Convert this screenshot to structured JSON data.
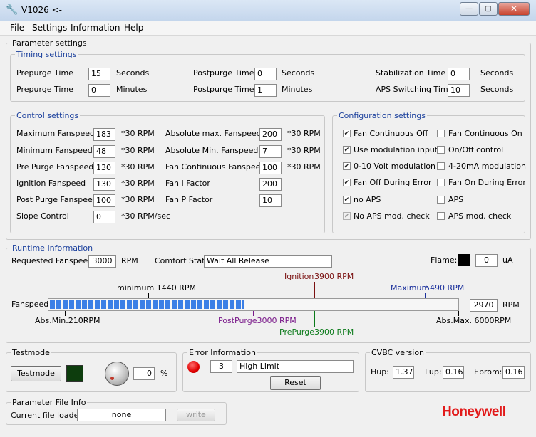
{
  "window": {
    "title": "V1026  <-"
  },
  "menu": [
    "File",
    "Settings",
    "Information",
    "Help"
  ],
  "parameter_settings": {
    "legend": "Parameter settings",
    "timing": {
      "legend": "Timing settings",
      "rows": [
        {
          "label": "Prepurge Time",
          "value": "15",
          "unit": "Seconds"
        },
        {
          "label": "Prepurge Time",
          "value": "0",
          "unit": "Minutes"
        },
        {
          "label": "Postpurge Time",
          "value": "0",
          "unit": "Seconds"
        },
        {
          "label": "Postpurge Time",
          "value": "1",
          "unit": "Minutes"
        },
        {
          "label": "Stabilization Time",
          "value": "0",
          "unit": "Seconds"
        },
        {
          "label": "APS Switching Time",
          "value": "10",
          "unit": "Seconds"
        }
      ]
    },
    "control": {
      "legend": "Control settings",
      "left": [
        {
          "label": "Maximum Fanspeed",
          "value": "183",
          "unit": "*30 RPM"
        },
        {
          "label": "Minimum Fanspeed",
          "value": "48",
          "unit": "*30 RPM"
        },
        {
          "label": "Pre Purge Fanspeed",
          "value": "130",
          "unit": "*30 RPM"
        },
        {
          "label": "Ignition Fanspeed",
          "value": "130",
          "unit": "*30 RPM"
        },
        {
          "label": "Post Purge Fanspeed",
          "value": "100",
          "unit": "*30 RPM"
        },
        {
          "label": "Slope Control",
          "value": "0",
          "unit": "*30 RPM/sec"
        }
      ],
      "right": [
        {
          "label": "Absolute max. Fanspeed",
          "value": "200",
          "unit": "*30 RPM"
        },
        {
          "label": "Absolute Min. Fanspeed",
          "value": "7",
          "unit": "*30 RPM"
        },
        {
          "label": "Fan Continuous Fanspeed",
          "value": "100",
          "unit": "*30 RPM"
        },
        {
          "label": "Fan I Factor",
          "value": "200",
          "unit": ""
        },
        {
          "label": "Fan P Factor",
          "value": "10",
          "unit": ""
        }
      ]
    },
    "config": {
      "legend": "Configuration settings",
      "left": [
        {
          "label": "Fan Continuous Off",
          "checked": true
        },
        {
          "label": "Use modulation input",
          "checked": true
        },
        {
          "label": "0-10 Volt modulation",
          "checked": true
        },
        {
          "label": "Fan Off During Error",
          "checked": true
        },
        {
          "label": "no APS",
          "checked": true
        },
        {
          "label": "No APS mod. check",
          "checked": true
        }
      ],
      "right": [
        {
          "label": "Fan Continuous On",
          "checked": false
        },
        {
          "label": "On/Off control",
          "checked": false
        },
        {
          "label": "4-20mA modulation",
          "checked": false
        },
        {
          "label": "Fan On During Error",
          "checked": false
        },
        {
          "label": "APS",
          "checked": false
        },
        {
          "label": "APS mod. check",
          "checked": false
        }
      ]
    }
  },
  "runtime": {
    "legend": "Runtime Information",
    "requested_label": "Requested Fanspeed:",
    "requested_value": "3000",
    "requested_unit": "RPM",
    "comfort_label": "Comfort State:",
    "comfort_value": "Wait All Release",
    "flame_label": "Flame:",
    "flame_value": "0",
    "flame_unit": "uA",
    "fanspeed_label": "Fanspeed",
    "fanspeed_value": "2970",
    "fanspeed_unit": "RPM",
    "bar_fill_fraction": 0.475,
    "markers": {
      "minimum": "minimum 1440 RPM",
      "ignition": "Ignition",
      "ignition_value": "3900 RPM",
      "maximum": "Maximum",
      "maximum_value": "5490 RPM",
      "abs_min": "Abs.Min.210RPM",
      "postpurge": "PostPurge3000 RPM",
      "prepurge": "PrePurge",
      "prepurge_value": "3900 RPM",
      "abs_max": "Abs.Max.  6000RPM"
    },
    "colors": {
      "ignition": "#7a1010",
      "maximum": "#1a2f9c",
      "postpurge": "#7a1a8a",
      "prepurge": "#0b7a1a"
    }
  },
  "testmode": {
    "legend": "Testmode",
    "button": "Testmode",
    "value": "0",
    "unit": "%"
  },
  "error": {
    "legend": "Error Information",
    "code": "3",
    "text": "High Limit",
    "reset": "Reset"
  },
  "cvbc": {
    "legend": "CVBC version",
    "hup_label": "Hup:",
    "hup_value": "1.37",
    "lup_label": "Lup:",
    "lup_value": "0.16",
    "eprom_label": "Eprom:",
    "eprom_value": "0.16"
  },
  "file_info": {
    "legend": "Parameter File Info",
    "label": "Current file loaded:",
    "value": "none",
    "write": "write"
  },
  "brand": "Honeywell"
}
